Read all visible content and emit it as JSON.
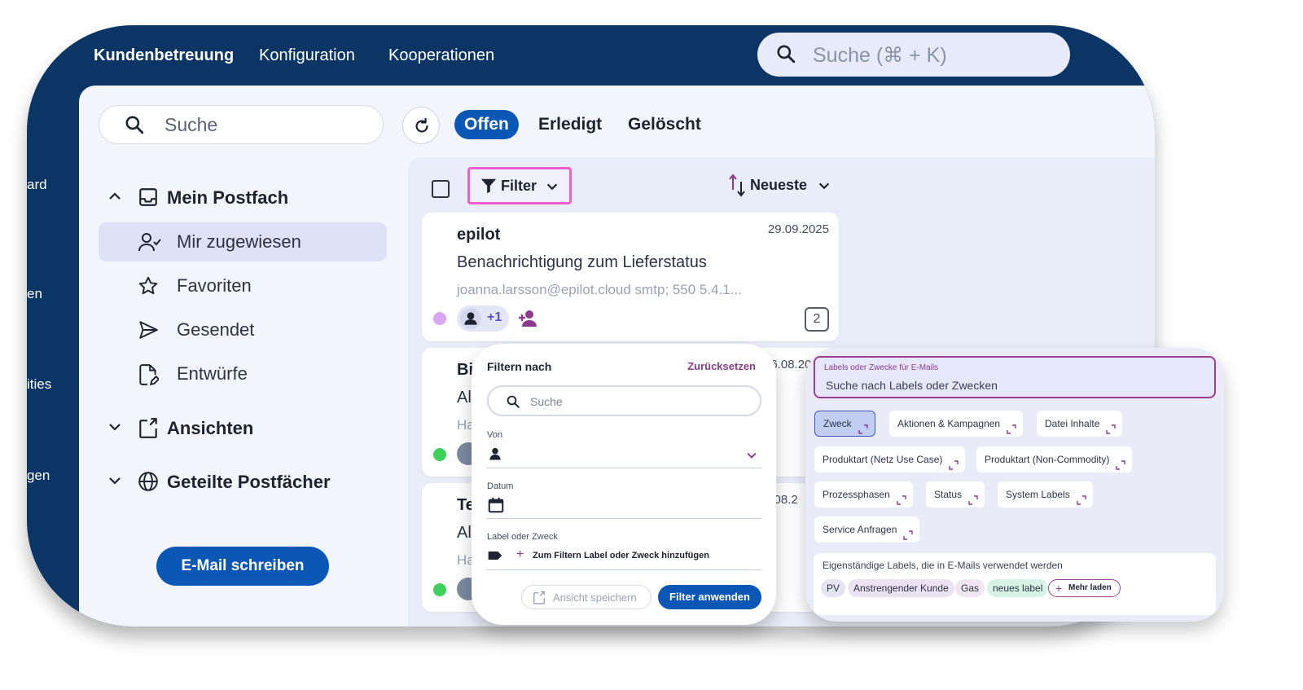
{
  "topbar": {
    "nav": [
      "Kundenbetreuung",
      "Konfiguration",
      "Kooperationen"
    ],
    "search_placeholder": "Suche (⌘ + K)"
  },
  "rail": [
    "ard",
    "en",
    "ities",
    "gen"
  ],
  "sidebar": {
    "search_placeholder": "Suche",
    "my_inbox": "Mein Postfach",
    "items": [
      "Mir zugewiesen",
      "Favoriten",
      "Gesendet",
      "Entwürfe"
    ],
    "views": "Ansichten",
    "shared": "Geteilte Postfächer",
    "compose": "E-Mail schreiben"
  },
  "tabs": [
    "Offen",
    "Erledigt",
    "Gelöscht"
  ],
  "toolbar": {
    "filter": "Filter",
    "sort": "Neueste"
  },
  "cards": [
    {
      "sender": "epilot",
      "date": "29.09.2025",
      "subject": "Benachrichtigung zum Lieferstatus",
      "preview": "joanna.larsson@epilot.cloud smtp; 550 5.4.1...",
      "assignees_more": "+1",
      "count": "2",
      "status_color": "#d9a6f2"
    },
    {
      "sender": "Bi",
      "date": "26.08.20",
      "subject": "Al",
      "preview": "Ha",
      "status_color": "#3dd15c"
    },
    {
      "sender": "Te",
      "date": "2.08.2",
      "subject": "Al",
      "preview": "Ha",
      "status_color": "#3dd15c"
    }
  ],
  "filter_popup": {
    "title": "Filtern nach",
    "reset": "Zurücksetzen",
    "search_placeholder": "Suche",
    "from_label": "Von",
    "date_label": "Datum",
    "label_label": "Label oder Zweck",
    "add_label": "Zum Filtern Label oder Zweck hinzufügen",
    "save_view": "Ansicht speichern",
    "apply": "Filter anwenden"
  },
  "labels_popup": {
    "caption": "Labels oder Zwecke für E-Mails",
    "placeholder": "Suche nach Labels oder Zwecken",
    "chips": [
      "Zweck",
      "Aktionen & Kampagnen",
      "Datei Inhalte",
      "Produktart (Netz Use Case)",
      "Produktart (Non-Commodity)",
      "Prozessphasen",
      "Status",
      "System Labels",
      "Service Anfragen"
    ],
    "own_caption": "Eigenständige Labels, die in E-Mails verwendet werden",
    "own_tags": [
      "PV",
      "Anstrengender Kunde",
      "Gas",
      "neues label"
    ],
    "load_more": "Mehr laden"
  },
  "colors": {
    "navy": "#0b3565",
    "primary": "#0b57b6",
    "highlight": "#ee5ed0",
    "accent_purple": "#8c3a8c"
  }
}
